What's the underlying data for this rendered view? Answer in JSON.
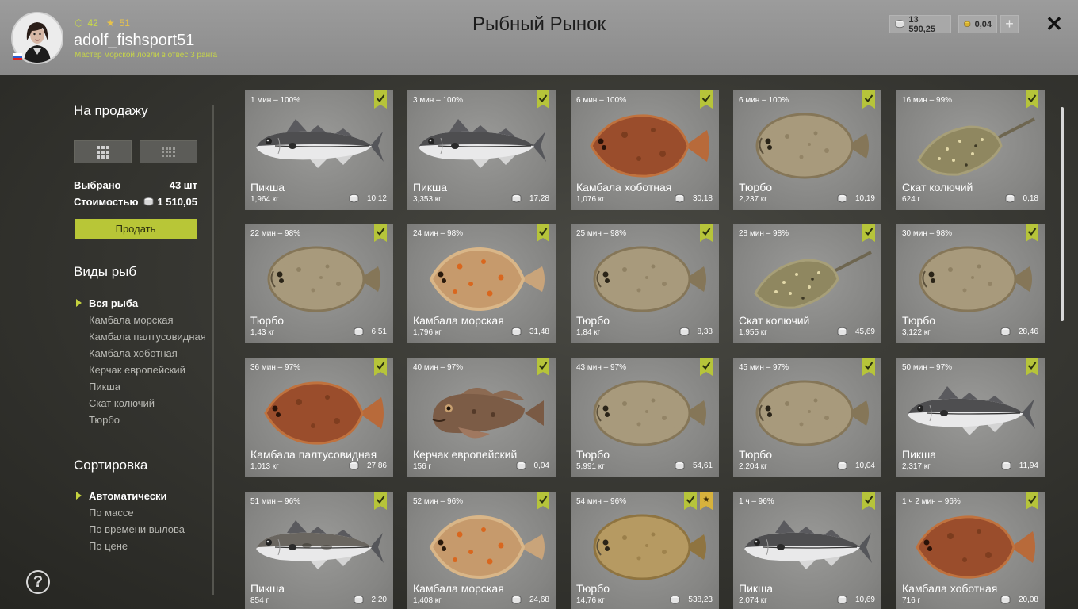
{
  "header": {
    "title": "Рыбный Рынок",
    "username": "adolf_fishsport51",
    "level": "42",
    "stars": "51",
    "rank": "Мастер морской ловли в отвес 3 ранга",
    "silver": "13 590,25",
    "gold": "0,04",
    "plus_label": "+",
    "close_label": "✕"
  },
  "sidebar": {
    "for_sale_title": "На продажу",
    "selected_label": "Выбрано",
    "selected_value": "43 шт",
    "cost_label": "Стоимостью",
    "cost_value": "1 510,05",
    "sell_label": "Продать",
    "species_title": "Виды рыб",
    "species": [
      {
        "label": "Вся рыба",
        "active": true
      },
      {
        "label": "Камбала морская",
        "active": false
      },
      {
        "label": "Камбала палтусовидная",
        "active": false
      },
      {
        "label": "Камбала хоботная",
        "active": false
      },
      {
        "label": "Керчак европейский",
        "active": false
      },
      {
        "label": "Пикша",
        "active": false
      },
      {
        "label": "Скат колючий",
        "active": false
      },
      {
        "label": "Тюрбо",
        "active": false
      }
    ],
    "sort_title": "Сортировка",
    "sort": [
      {
        "label": "Автоматически",
        "active": true
      },
      {
        "label": "По массе",
        "active": false
      },
      {
        "label": "По времени вылова",
        "active": false
      },
      {
        "label": "По цене",
        "active": false
      }
    ],
    "help_label": "?"
  },
  "colors": {
    "accent": "#b8c637",
    "badge_green": "#b6c43a",
    "badge_gold": "#d7b23c"
  },
  "cards": [
    {
      "time": "1 мин – 100%",
      "name": "Пикша",
      "weight": "1,964 кг",
      "price": "10,12",
      "fish": "haddock"
    },
    {
      "time": "3 мин – 100%",
      "name": "Пикша",
      "weight": "3,353 кг",
      "price": "17,28",
      "fish": "haddock"
    },
    {
      "time": "6 мин – 100%",
      "name": "Камбала хоботная",
      "weight": "1,076 кг",
      "price": "30,18",
      "fish": "flounder-brown"
    },
    {
      "time": "6 мин – 100%",
      "name": "Тюрбо",
      "weight": "2,237 кг",
      "price": "10,19",
      "fish": "turbot"
    },
    {
      "time": "16 мин – 99%",
      "name": "Скат колючий",
      "weight": "624 г",
      "price": "0,18",
      "fish": "ray"
    },
    {
      "time": "22 мин – 98%",
      "name": "Тюрбо",
      "weight": "1,43 кг",
      "price": "6,51",
      "fish": "turbot"
    },
    {
      "time": "24 мин – 98%",
      "name": "Камбала морская",
      "weight": "1,796 кг",
      "price": "31,48",
      "fish": "plaice"
    },
    {
      "time": "25 мин – 98%",
      "name": "Тюрбо",
      "weight": "1,84 кг",
      "price": "8,38",
      "fish": "turbot"
    },
    {
      "time": "28 мин – 98%",
      "name": "Скат колючий",
      "weight": "1,955 кг",
      "price": "45,69",
      "fish": "ray"
    },
    {
      "time": "30 мин – 98%",
      "name": "Тюрбо",
      "weight": "3,122 кг",
      "price": "28,46",
      "fish": "turbot"
    },
    {
      "time": "36 мин – 97%",
      "name": "Камбала палтусовидная",
      "weight": "1,013 кг",
      "price": "27,86",
      "fish": "flounder-brown"
    },
    {
      "time": "40 мин – 97%",
      "name": "Керчак европейский",
      "weight": "156 г",
      "price": "0,04",
      "fish": "sculpin"
    },
    {
      "time": "43 мин – 97%",
      "name": "Тюрбо",
      "weight": "5,991 кг",
      "price": "54,61",
      "fish": "turbot"
    },
    {
      "time": "45 мин – 97%",
      "name": "Тюрбо",
      "weight": "2,204 кг",
      "price": "10,04",
      "fish": "turbot"
    },
    {
      "time": "50 мин – 97%",
      "name": "Пикша",
      "weight": "2,317 кг",
      "price": "11,94",
      "fish": "haddock"
    },
    {
      "time": "51 мин – 96%",
      "name": "Пикша",
      "weight": "854 г",
      "price": "2,20",
      "fish": "haddock-light"
    },
    {
      "time": "52 мин – 96%",
      "name": "Камбала морская",
      "weight": "1,408 кг",
      "price": "24,68",
      "fish": "plaice"
    },
    {
      "time": "54 мин – 96%",
      "name": "Тюрбо",
      "weight": "14,76 кг",
      "price": "538,23",
      "fish": "turbot-gold",
      "star": true
    },
    {
      "time": "1 ч – 96%",
      "name": "Пикша",
      "weight": "2,074 кг",
      "price": "10,69",
      "fish": "haddock"
    },
    {
      "time": "1 ч 2 мин – 96%",
      "name": "Камбала хоботная",
      "weight": "716 г",
      "price": "20,08",
      "fish": "flounder-brown"
    }
  ]
}
